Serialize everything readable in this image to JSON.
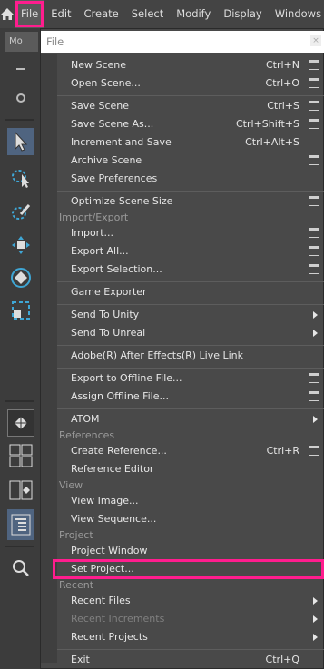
{
  "menubar": {
    "items": [
      {
        "label": "File",
        "active": true
      },
      {
        "label": "Edit"
      },
      {
        "label": "Create"
      },
      {
        "label": "Select"
      },
      {
        "label": "Modify"
      },
      {
        "label": "Display"
      },
      {
        "label": "Windows"
      }
    ]
  },
  "toolbar": {
    "mode_tab": "Mo"
  },
  "file_menu": {
    "title": "File",
    "close_glyph": "×",
    "items": [
      {
        "label": "New Scene",
        "shortcut": "Ctrl+N",
        "options": true
      },
      {
        "label": "Open Scene...",
        "shortcut": "Ctrl+O",
        "options": true
      },
      {
        "label": "Save Scene",
        "shortcut": "Ctrl+S",
        "options": true
      },
      {
        "label": "Save Scene As...",
        "shortcut": "Ctrl+Shift+S",
        "options": true
      },
      {
        "label": "Increment and Save",
        "shortcut": "Ctrl+Alt+S",
        "options": false
      },
      {
        "label": "Archive Scene",
        "shortcut": "",
        "options": true
      },
      {
        "label": "Save Preferences",
        "shortcut": "",
        "options": false
      },
      {
        "label": "Optimize Scene Size",
        "shortcut": "",
        "options": true
      },
      {
        "label": "Import...",
        "shortcut": "",
        "options": true
      },
      {
        "label": "Export All...",
        "shortcut": "",
        "options": true
      },
      {
        "label": "Export Selection...",
        "shortcut": "",
        "options": true
      },
      {
        "label": "Game Exporter",
        "shortcut": "",
        "options": false
      },
      {
        "label": "Send To Unity",
        "shortcut": "",
        "submenu": true
      },
      {
        "label": "Send To Unreal",
        "shortcut": "",
        "submenu": true
      },
      {
        "label": "Adobe(R) After Effects(R) Live Link",
        "shortcut": ""
      },
      {
        "label": "Export to Offline File...",
        "shortcut": "",
        "options": true
      },
      {
        "label": "Assign Offline File...",
        "shortcut": "",
        "options": true
      },
      {
        "label": "ATOM",
        "shortcut": "",
        "submenu": true
      },
      {
        "label": "Create Reference...",
        "shortcut": "Ctrl+R",
        "options": true
      },
      {
        "label": "Reference Editor",
        "shortcut": ""
      },
      {
        "label": "View Image...",
        "shortcut": ""
      },
      {
        "label": "View Sequence...",
        "shortcut": ""
      },
      {
        "label": "Project Window",
        "shortcut": ""
      },
      {
        "label": "Set Project...",
        "shortcut": "",
        "highlighted": true
      },
      {
        "label": "Recent Files",
        "shortcut": "",
        "submenu": true
      },
      {
        "label": "Recent Increments",
        "shortcut": "",
        "submenu": true,
        "disabled": true
      },
      {
        "label": "Recent Projects",
        "shortcut": "",
        "submenu": true
      },
      {
        "label": "Exit",
        "shortcut": "Ctrl+Q"
      }
    ],
    "sections": {
      "import_export": "Import/Export",
      "references": "References",
      "view": "View",
      "project": "Project",
      "recent": "Recent"
    }
  },
  "colors": {
    "highlight": "#ff1d8e",
    "menu_bg": "#494949",
    "selected_tool": "#4f6480"
  }
}
